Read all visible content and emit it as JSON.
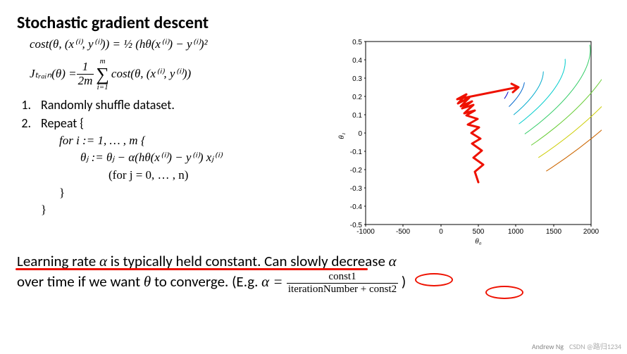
{
  "title": "Stochastic gradient descent",
  "eq_cost": "cost(θ, (x⁽ⁱ⁾, y⁽ⁱ⁾)) = ½ (hθ(x⁽ⁱ⁾) − y⁽ⁱ⁾)²",
  "eq_j_left": "Jₜᵣₐᵢₙ(θ) = ",
  "eq_j_frac_num": "1",
  "eq_j_frac_den": "2m",
  "eq_j_sum_top": "m",
  "eq_j_sum_sym": "∑",
  "eq_j_sum_bot": "i=1",
  "eq_j_right": " cost(θ, (x⁽ⁱ⁾, y⁽ⁱ⁾))",
  "step1_num": "1.",
  "step1_text": "Randomly shuffle dataset.",
  "step2_num": "2.",
  "step2_text": "Repeat {",
  "inner_for": "for i := 1, … , m           {",
  "inner_update": "θⱼ := θⱼ − α(hθ(x⁽ⁱ⁾) − y⁽ⁱ⁾) xⱼ⁽ⁱ⁾",
  "inner_forj": "(for j = 0, … , n)",
  "inner_close1": "}",
  "inner_close2": "}",
  "bottom_line1a": "Learning rate ",
  "bottom_alpha": "α",
  "bottom_line1b": " is typically held constant.",
  "bottom_line1c": " Can slowly decrease ",
  "bottom_line2a": "over time if we want ",
  "bottom_theta": "θ",
  "bottom_line2b": "  to converge. (E.g. ",
  "bottom_eq_lhs": "α = ",
  "bottom_frac_num": "const1",
  "bottom_frac_den_a": "iterationNumber + ",
  "bottom_frac_den_b": "const2",
  "bottom_close": " )",
  "watermark": "CSDN @路归1234",
  "credit": "Andrew Ng",
  "chart_data": {
    "type": "contour",
    "title": "",
    "xlabel": "θ₀",
    "ylabel": "θ₁",
    "xlim": [
      -1000,
      2000
    ],
    "ylim": [
      -0.5,
      0.5
    ],
    "xticks": [
      -1000,
      -500,
      0,
      500,
      1000,
      1500,
      2000
    ],
    "yticks": [
      -0.5,
      -0.4,
      -0.3,
      -0.2,
      -0.1,
      0,
      0.1,
      0.2,
      0.3,
      0.4,
      0.5
    ],
    "center": [
      400,
      0.15
    ],
    "contour_levels": 10,
    "sgd_path": [
      [
        500,
        -0.27
      ],
      [
        460,
        -0.2
      ],
      [
        520,
        -0.15
      ],
      [
        450,
        -0.1
      ],
      [
        510,
        -0.05
      ],
      [
        430,
        0.0
      ],
      [
        490,
        0.05
      ],
      [
        420,
        0.08
      ],
      [
        470,
        0.12
      ],
      [
        380,
        0.15
      ],
      [
        450,
        0.17
      ],
      [
        370,
        0.14
      ],
      [
        430,
        0.19
      ],
      [
        360,
        0.16
      ],
      [
        400,
        0.2
      ],
      [
        340,
        0.15
      ],
      [
        410,
        0.22
      ],
      [
        350,
        0.18
      ],
      [
        1000,
        0.25
      ]
    ]
  }
}
